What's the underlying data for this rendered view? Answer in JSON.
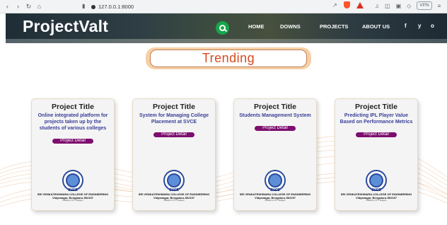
{
  "browser": {
    "url": "127.0.0.1:8000",
    "vpn_label": "VPN"
  },
  "site": {
    "logo": "ProjectValt",
    "menu": [
      {
        "label": "HOME"
      },
      {
        "label": "DOWNS"
      },
      {
        "label": "PROJECTS"
      },
      {
        "label": "ABOUT US"
      }
    ],
    "social": [
      "f",
      "y",
      "o"
    ]
  },
  "trending": {
    "title": "Trending"
  },
  "cards": [
    {
      "title": "Project Title",
      "name": "Online integrated platform for projects taken up by the students of various colleges",
      "button": "Project Detail",
      "seal": "SVCE",
      "college": "SRI VENKATESHWARA COLLEGE OF ENGINEERING",
      "address": "Vidyanagar, Bengaluru-562157",
      "note": "Affiliated to VTU, Belagavi"
    },
    {
      "title": "Project Title",
      "name": "System for Managing College Placement at SVCE",
      "button": "Project Detail",
      "seal": "SVCE",
      "college": "SRI VENKATESHWARA COLLEGE OF ENGINEERING",
      "address": "Vidyanagar, Bengaluru-562157",
      "note": "Affiliated to VTU, Belagavi"
    },
    {
      "title": "Project Title",
      "name": "Students Management System",
      "button": "Project Detail",
      "seal": "SVCE",
      "college": "SRI VENKATESHWARA COLLEGE OF ENGINEERING",
      "address": "Vidyanagar, Bengaluru-562157",
      "note": "Affiliated to VTU, Belagavi"
    },
    {
      "title": "Project Title",
      "name": "Predicting IPL Player Value Based on Performance Metrics",
      "button": "Project Detail",
      "seal": "SVCE",
      "college": "SRI VENKATESHWARA COLLEGE OF ENGINEERING",
      "address": "Vidyanagar, Bengaluru-562157",
      "note": "Affiliated to VTU, Belagavi"
    }
  ],
  "colors": {
    "accent_title": "#d84a1f",
    "project_name": "#3a3f98",
    "detail_button": "#7d0f6e",
    "search_button": "#17a64a"
  }
}
